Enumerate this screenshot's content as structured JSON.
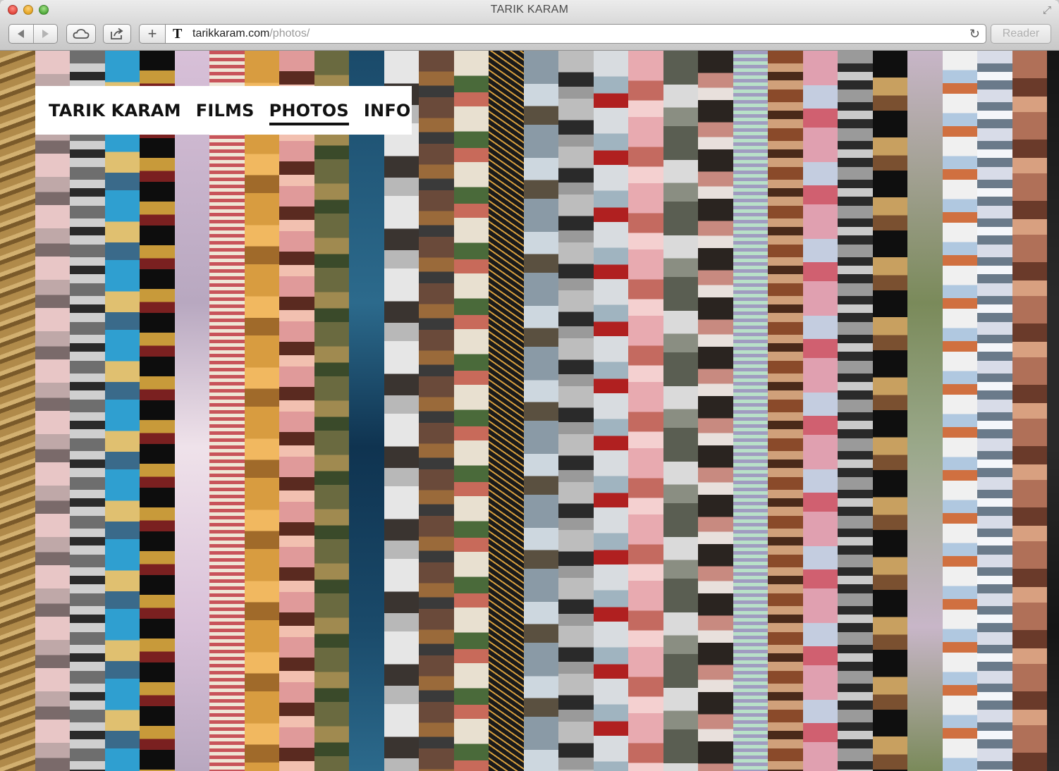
{
  "window": {
    "title": "TARIK KARAM"
  },
  "toolbar": {
    "back_icon": "back-arrow-icon",
    "forward_icon": "forward-arrow-icon",
    "cloud_icon": "icloud-tabs-icon",
    "share_icon": "share-icon",
    "new_tab_label": "+",
    "favicon": "T",
    "url_host": "tarikkaram.com",
    "url_path": "/photos/",
    "reader_label": "Reader",
    "reload_icon": "reload-icon"
  },
  "site": {
    "brand": "TARIK KARAM",
    "nav": [
      {
        "label": "FILMS",
        "active": false
      },
      {
        "label": "PHOTOS",
        "active": true
      },
      {
        "label": "INFO",
        "active": false
      }
    ]
  },
  "photo_strips": [
    {
      "colors": [
        "#b08a4a",
        "#d2b070",
        "#7a5a2a"
      ],
      "pattern": "diag"
    },
    {
      "colors": [
        "#e8c6c6",
        "#bfa8a8",
        "#7a6a6a"
      ],
      "pattern": "blocks"
    },
    {
      "colors": [
        "#6e6e6e",
        "#cfcfcf",
        "#2a2a2a"
      ],
      "pattern": "noise"
    },
    {
      "colors": [
        "#2f9fd0",
        "#e0c070",
        "#3a6a8a"
      ],
      "pattern": "blocks"
    },
    {
      "colors": [
        "#0d0d0d",
        "#c89a3a",
        "#7a2020"
      ],
      "pattern": "blocks"
    },
    {
      "colors": [
        "#d8c0d8",
        "#b8a8c0",
        "#efe2ea"
      ],
      "pattern": "soft"
    },
    {
      "colors": [
        "#c8545a",
        "#efe6d6"
      ],
      "pattern": "stripes"
    },
    {
      "colors": [
        "#d89c40",
        "#f1b860",
        "#a06a2a"
      ],
      "pattern": "blocks"
    },
    {
      "colors": [
        "#e09a9a",
        "#5a2a20",
        "#f2c0b0"
      ],
      "pattern": "blocks"
    },
    {
      "colors": [
        "#6a6a40",
        "#a08a50",
        "#3a4a2a"
      ],
      "pattern": "blocks"
    },
    {
      "colors": [
        "#1a4a6a",
        "#2c6a8c",
        "#0f3350"
      ],
      "pattern": "soft"
    },
    {
      "colors": [
        "#e6e6e6",
        "#3a3430",
        "#b8b8b8"
      ],
      "pattern": "blocks"
    },
    {
      "colors": [
        "#6a4a3a",
        "#9a6a3a",
        "#3a3a3a"
      ],
      "pattern": "blocks"
    },
    {
      "colors": [
        "#e8e0d0",
        "#4a6a3a",
        "#c86a5a"
      ],
      "pattern": "blocks"
    },
    {
      "colors": [
        "#1a1a1a",
        "#d8a040"
      ],
      "pattern": "zigzag"
    },
    {
      "colors": [
        "#8a9aa6",
        "#cdd7df",
        "#5a5040"
      ],
      "pattern": "blocks"
    },
    {
      "colors": [
        "#bdbdbd",
        "#2a2a2a",
        "#9a9a9a"
      ],
      "pattern": "blocks"
    },
    {
      "colors": [
        "#d8dce0",
        "#a0b4c0",
        "#b02020"
      ],
      "pattern": "blocks"
    },
    {
      "colors": [
        "#e8aab0",
        "#c46a60",
        "#f4d0d0"
      ],
      "pattern": "blocks"
    },
    {
      "colors": [
        "#5a5e52",
        "#dadada",
        "#8a8e82"
      ],
      "pattern": "blocks"
    },
    {
      "colors": [
        "#2a2420",
        "#c88a80",
        "#e8e0dc"
      ],
      "pattern": "blocks"
    },
    {
      "colors": [
        "#a09cc0",
        "#b8e0c8",
        "#4a4048"
      ],
      "pattern": "stripes"
    },
    {
      "colors": [
        "#8a4a2a",
        "#d0a07a",
        "#4a2a1a"
      ],
      "pattern": "noise"
    },
    {
      "colors": [
        "#e0a0b0",
        "#c4cde0",
        "#d06070"
      ],
      "pattern": "blocks"
    },
    {
      "colors": [
        "#9a9a9a",
        "#2a2a2a",
        "#cacaca"
      ],
      "pattern": "noise"
    },
    {
      "colors": [
        "#0f0f0f",
        "#c8a060",
        "#7a5030"
      ],
      "pattern": "blocks"
    },
    {
      "colors": [
        "#c8b6c8",
        "#7a8a5a",
        "#9aa88a"
      ],
      "pattern": "soft"
    },
    {
      "colors": [
        "#f0f0f0",
        "#b0c8e0",
        "#d07040"
      ],
      "pattern": "blocks"
    },
    {
      "colors": [
        "#d8dce8",
        "#6a7a8a",
        "#f4f6fa"
      ],
      "pattern": "noise"
    },
    {
      "colors": [
        "#b07058",
        "#6a3a2a",
        "#d8a080"
      ],
      "pattern": "blocks"
    },
    {
      "colors": [
        "#151515",
        "#2a2a2a"
      ],
      "pattern": "soft"
    }
  ]
}
